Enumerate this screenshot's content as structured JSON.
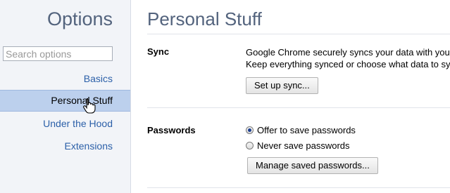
{
  "sidebar": {
    "title": "Options",
    "search_placeholder": "Search options",
    "items": [
      {
        "label": "Basics"
      },
      {
        "label": "Personal Stuff",
        "selected": true
      },
      {
        "label": "Under the Hood"
      },
      {
        "label": "Extensions"
      }
    ]
  },
  "main": {
    "title": "Personal Stuff",
    "sync": {
      "label": "Sync",
      "line1": "Google Chrome securely syncs your data with you",
      "line2": "Keep everything synced or choose what data to sy",
      "button": "Set up sync..."
    },
    "passwords": {
      "label": "Passwords",
      "options": [
        {
          "label": "Offer to save passwords",
          "checked": true
        },
        {
          "label": "Never save passwords",
          "checked": false
        }
      ],
      "button": "Manage saved passwords..."
    }
  },
  "colors": {
    "accent_text": "#53637d",
    "link": "#2b5fa8",
    "selected_bg": "#bcd0ed",
    "sidebar_bg": "#f2f4f8"
  }
}
